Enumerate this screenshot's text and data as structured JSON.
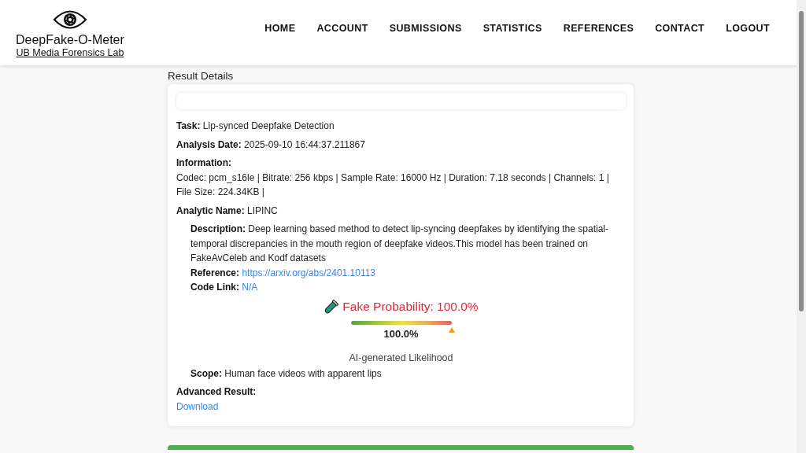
{
  "header": {
    "title": "DeepFake-O-Meter",
    "subtitle": "UB Media Forensics Lab",
    "nav": [
      "HOME",
      "ACCOUNT",
      "SUBMISSIONS",
      "STATISTICS",
      "REFERENCES",
      "CONTACT",
      "LOGOUT"
    ]
  },
  "page_title": "Result Details",
  "fields": [
    {
      "kind": "inline",
      "label": "Task:",
      "value": "Lip-synced Deepfake Detection"
    },
    {
      "kind": "inline",
      "label": "Analysis Date:",
      "value": "2025-09-10 16:44:37.211867"
    },
    {
      "kind": "block",
      "label": "Information:",
      "value": "Codec: pcm_s16le | Bitrate: 256 kbps | Sample Rate: 16000 Hz | Duration: 7.18 seconds | Channels: 1 | File Size: 224.34KB |"
    },
    {
      "kind": "inline",
      "label": "Analytic Name:",
      "value": "LIPINC"
    }
  ],
  "details": [
    {
      "kind": "text",
      "label": "Description:",
      "value": "Deep learning based method to detect lip-syncing deepfakes by identifying the spatial-temporal discrepancies in the mouth region of deepfake videos.This model has been trained on FakeAvCeleb and Kodf datasets"
    },
    {
      "kind": "link",
      "label": "Reference:",
      "value": "https://arxiv.org/abs/2401.10113"
    },
    {
      "kind": "link",
      "label": "Code Link:",
      "value": "N/A"
    }
  ],
  "result": {
    "title": "Fake Probability: 100.0%",
    "level": 1.0,
    "reading": "100.0%",
    "caption": "AI-generated Likelihood"
  },
  "scope": {
    "label": "Scope:",
    "value": "Human face videos with apparent lips"
  },
  "advanced": {
    "label": "Advanced Result:",
    "link": "Download"
  }
}
